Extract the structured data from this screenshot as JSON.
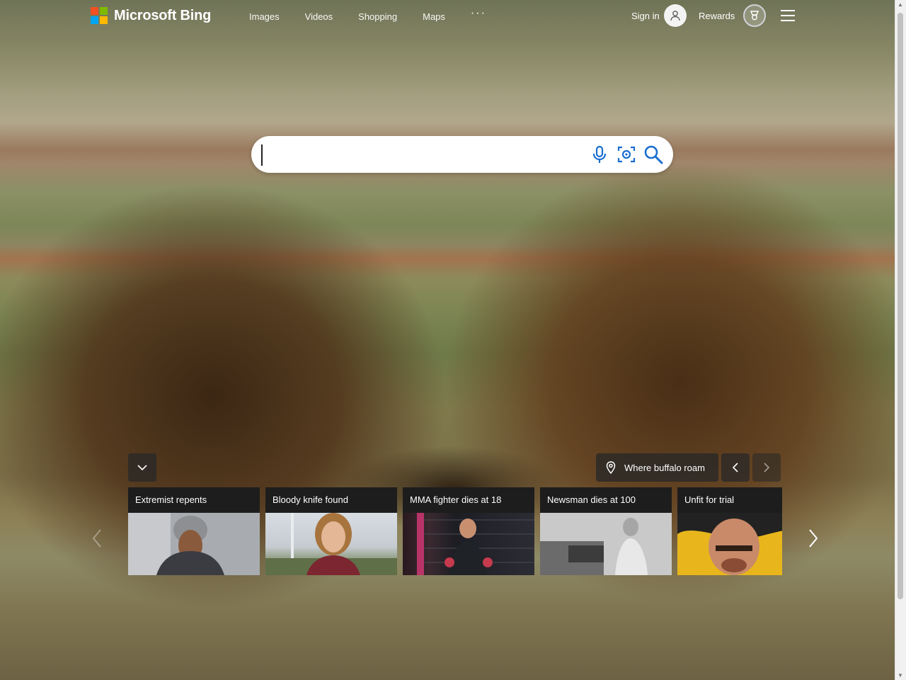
{
  "header": {
    "brand": "Microsoft Bing",
    "nav": [
      "Images",
      "Videos",
      "Shopping",
      "Maps"
    ],
    "more": "···",
    "signin_label": "Sign in",
    "rewards_label": "Rewards"
  },
  "search": {
    "value": "",
    "placeholder": ""
  },
  "image_info": {
    "title": "Where buffalo roam"
  },
  "news": [
    {
      "title": "Extremist repents"
    },
    {
      "title": "Bloody knife found"
    },
    {
      "title": "MMA fighter dies at 18"
    },
    {
      "title": "Newsman dies at 100"
    },
    {
      "title": "Unfit for trial"
    }
  ],
  "colors": {
    "ms_red": "#f25022",
    "ms_green": "#7fba00",
    "ms_blue": "#00a4ef",
    "ms_yellow": "#ffb900",
    "search_blue": "#1a6ed1"
  },
  "icons": [
    "microsoft-logo-icon",
    "more-icon",
    "user-icon",
    "rewards-medal-icon",
    "hamburger-menu-icon",
    "microphone-icon",
    "visual-search-icon",
    "search-icon",
    "chevron-down-icon",
    "location-pin-icon",
    "chevron-left-icon",
    "chevron-right-icon"
  ]
}
